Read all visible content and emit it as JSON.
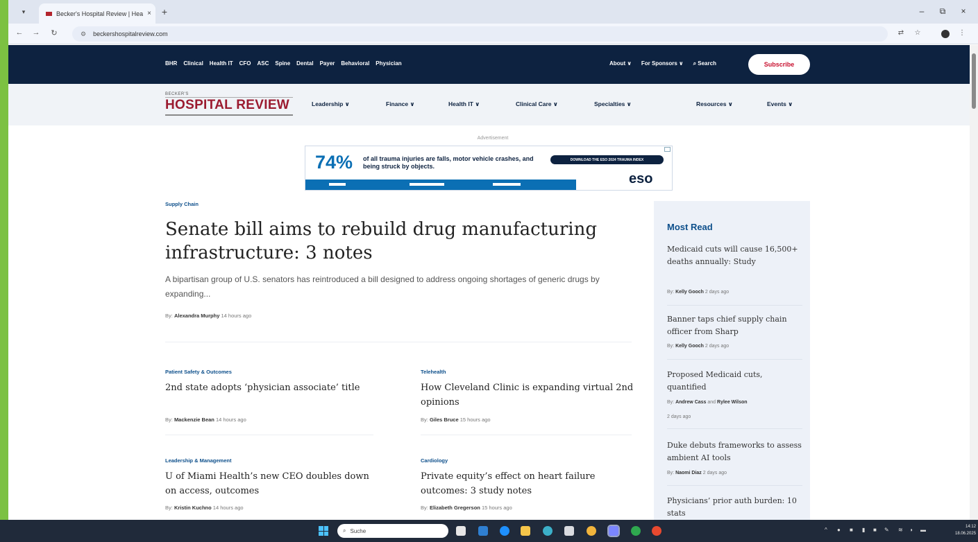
{
  "browser": {
    "tab_title": "Becker's Hospital Review | Hea",
    "tab_close": "×",
    "new_tab": "+",
    "url": "beckershospitalreview.com",
    "minimize": "–",
    "maximize": "⧉",
    "close": "×",
    "icons": [
      "tab-search-icon",
      "back-icon",
      "forward-icon",
      "reload-icon",
      "site-info-icon",
      "translate-icon",
      "star-icon",
      "profile-icon",
      "menu-icon"
    ]
  },
  "topnav": {
    "brand": "BHR",
    "links": [
      "Clinical",
      "Health IT",
      "CFO",
      "ASC",
      "Spine",
      "Dental",
      "Payer",
      "Behavioral",
      "Physician"
    ],
    "about": "About ∨",
    "sponsors": "For Sponsors ∨",
    "search": "Search",
    "subscribe": "Subscribe"
  },
  "logo": {
    "small": "BECKER'S",
    "big": "HOSPITAL REVIEW"
  },
  "mainnav": {
    "items": [
      "Leadership ∨",
      "Finance ∨",
      "Health IT ∨",
      "Clinical Care ∨",
      "Specialties ∨",
      "Resources ∨",
      "Events ∨"
    ]
  },
  "ad": {
    "label": "Advertisement",
    "percent": "74%",
    "copy": "of all trauma injuries are falls, motor vehicle crashes, and being struck by objects.",
    "cta": "DOWNLOAD THE ESO 2024 TRAUMA INDEX",
    "brand": "eso"
  },
  "lead": {
    "category": "Supply Chain",
    "headline": "Senate bill aims to rebuild drug manufacturing infrastructure: 3 notes",
    "dek": "A bipartisan group of U.S. senators has reintroduced a bill designed to address ongoing shortages of generic drugs by expanding...",
    "by": "By:",
    "author": "Alexandra Murphy",
    "time": "14 hours ago"
  },
  "stories": [
    {
      "category": "Patient Safety & Outcomes",
      "title": "2nd state adopts ‘physician associate’ title",
      "by": "By:",
      "author": "Mackenzie Bean",
      "time": "14 hours ago"
    },
    {
      "category": "Telehealth",
      "title": "How Cleveland Clinic is expanding virtual 2nd opinions",
      "by": "By:",
      "author": "Giles Bruce",
      "time": "15 hours ago"
    },
    {
      "category": "Leadership & Management",
      "title": "U of Miami Health’s new CEO doubles down on access, outcomes",
      "by": "By:",
      "author": "Kristin Kuchno",
      "time": "14 hours ago"
    },
    {
      "category": "Cardiology",
      "title": "Private equity’s effect on heart failure outcomes: 3 study notes",
      "by": "By:",
      "author": "Elizabeth Gregerson",
      "time": "15 hours ago"
    }
  ],
  "most_read": {
    "heading": "Most Read",
    "items": [
      {
        "title": "Medicaid cuts will cause 16,500+ deaths annually: Study",
        "by": "By:",
        "author": "Kelly Gooch",
        "and": "",
        "author2": "",
        "time": "2 days ago"
      },
      {
        "title": "Banner taps chief supply chain officer from Sharp",
        "by": "By:",
        "author": "Kelly Gooch",
        "and": "",
        "author2": "",
        "time": "2 days ago"
      },
      {
        "title": "Proposed Medicaid cuts, quantified",
        "by": "By:",
        "author": "Andrew Cass",
        "and": "and",
        "author2": "Rylee Wilson",
        "time": "2 days ago"
      },
      {
        "title": "Duke debuts frameworks to assess ambient AI tools",
        "by": "By:",
        "author": "Naomi Diaz",
        "and": "",
        "author2": "",
        "time": "2 days ago"
      },
      {
        "title": "Physicians’ prior auth burden: 10 stats",
        "by": "",
        "author": "",
        "and": "",
        "author2": "",
        "time": ""
      }
    ]
  },
  "taskbar": {
    "search": "Suche",
    "time": "14:12",
    "date": "18.06.2025"
  },
  "colors": {
    "navy": "#0d2240",
    "brand_red": "#9b1b30",
    "accent_blue": "#0d4f8b",
    "desktop_green": "#7cc142"
  }
}
